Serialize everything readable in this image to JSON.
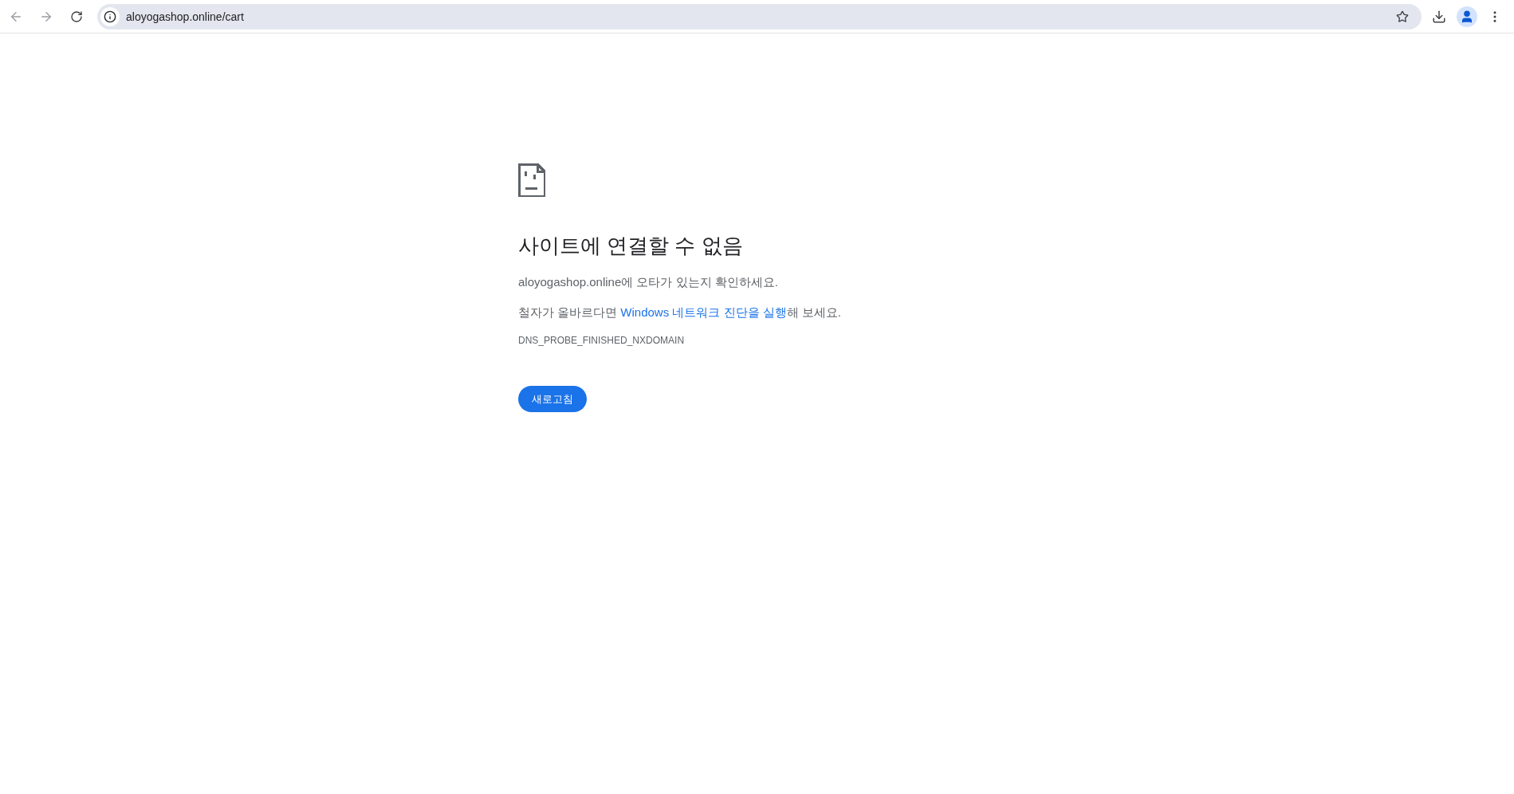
{
  "address_bar": {
    "url": "aloyogashop.online/cart"
  },
  "error": {
    "title": "사이트에 연결할 수 없음",
    "message": "aloyogashop.online에 오타가 있는지 확인하세요.",
    "suggestion": {
      "before": "철자가 올바르다면 ",
      "link": "Windows 네트워크 진단을 실행",
      "after": "해 보세요."
    },
    "code": "DNS_PROBE_FINISHED_NXDOMAIN",
    "button": "새로고침"
  }
}
